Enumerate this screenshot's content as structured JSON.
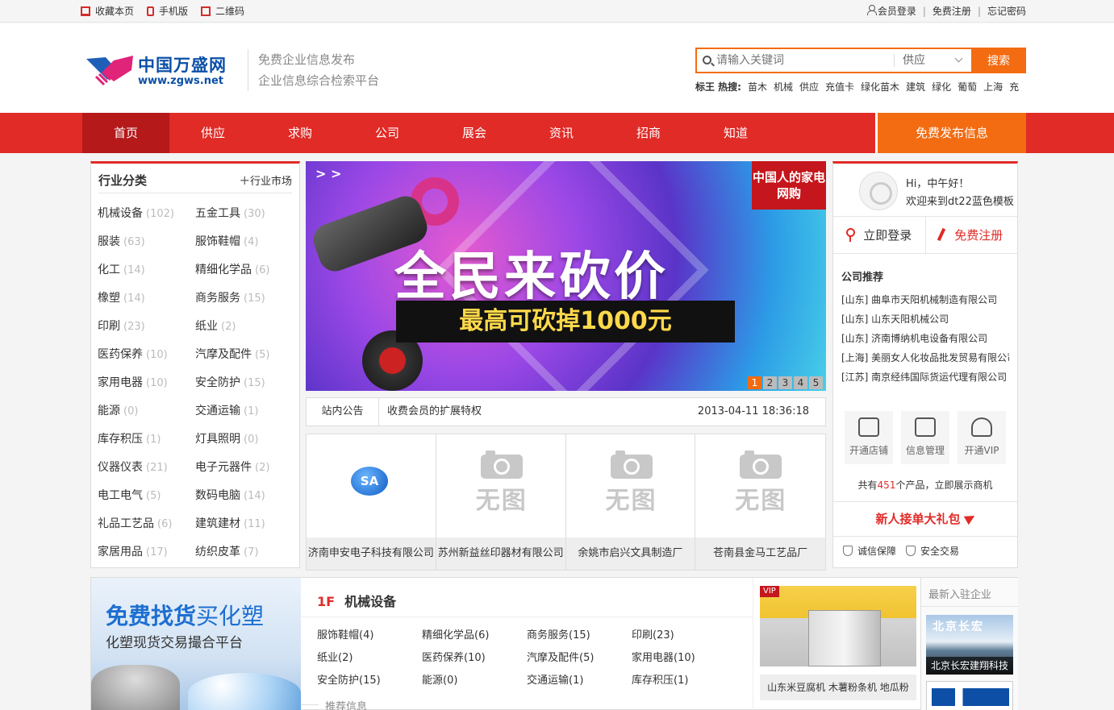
{
  "topbar": {
    "left": [
      "收藏本页",
      "手机版",
      "二维码"
    ],
    "login": "会员登录",
    "register": "免费注册",
    "forgot": "忘记密码",
    "sep": "|"
  },
  "logo": {
    "brand": "中国万盛网",
    "url": "www.zgws.net"
  },
  "slogan": [
    "免费企业信息发布",
    "企业信息综合检索平台"
  ],
  "search": {
    "placeholder": "请输入关键词",
    "type": "供应",
    "button": "搜索"
  },
  "hot": {
    "label": "标王 热搜:",
    "words": [
      "苗木",
      "机械",
      "供应",
      "充值卡",
      "绿化苗木",
      "建筑",
      "绿化",
      "葡萄",
      "上海",
      "充"
    ]
  },
  "nav": {
    "items": [
      "首页",
      "供应",
      "求购",
      "公司",
      "展会",
      "资讯",
      "招商",
      "知道"
    ],
    "publish": "免费发布信息"
  },
  "categories": {
    "title": "行业分类",
    "market": "行业市场",
    "items": [
      {
        "name": "机械设备",
        "count": "(102)"
      },
      {
        "name": "五金工具",
        "count": "(30)"
      },
      {
        "name": "服装",
        "count": "(63)"
      },
      {
        "name": "服饰鞋帽",
        "count": "(4)"
      },
      {
        "name": "化工",
        "count": "(14)"
      },
      {
        "name": "精细化学品",
        "count": "(6)"
      },
      {
        "name": "橡塑",
        "count": "(14)"
      },
      {
        "name": "商务服务",
        "count": "(15)"
      },
      {
        "name": "印刷",
        "count": "(23)"
      },
      {
        "name": "纸业",
        "count": "(2)"
      },
      {
        "name": "医药保养",
        "count": "(10)"
      },
      {
        "name": "汽摩及配件",
        "count": "(5)"
      },
      {
        "name": "家用电器",
        "count": "(10)"
      },
      {
        "name": "安全防护",
        "count": "(15)"
      },
      {
        "name": "能源",
        "count": "(0)"
      },
      {
        "name": "交通运输",
        "count": "(1)"
      },
      {
        "name": "库存积压",
        "count": "(1)"
      },
      {
        "name": "灯具照明",
        "count": "(0)"
      },
      {
        "name": "仪器仪表",
        "count": "(21)"
      },
      {
        "name": "电子元器件",
        "count": "(2)"
      },
      {
        "name": "电工电气",
        "count": "(5)"
      },
      {
        "name": "数码电脑",
        "count": "(14)"
      },
      {
        "name": "礼品工艺品",
        "count": "(6)"
      },
      {
        "name": "建筑建材",
        "count": "(11)"
      },
      {
        "name": "家居用品",
        "count": "(17)"
      },
      {
        "name": "纺织皮革",
        "count": "(7)"
      }
    ]
  },
  "banner": {
    "main": "全民来砍价",
    "sub": "最高可砍掉1000元",
    "corner": "中国人的家电网购",
    "arrows": "> >",
    "dots": [
      "1",
      "2",
      "3",
      "4",
      "5"
    ],
    "active_dot": 0
  },
  "notice": {
    "label": "站内公告",
    "text": "收费会员的扩展特权",
    "time": "2013-04-11 18:36:18"
  },
  "companies": [
    {
      "name": "济南申安电子科技有限公司",
      "logo": "SA"
    },
    {
      "name": "苏州新益丝印器材有限公司",
      "noimg": "无图"
    },
    {
      "name": "余姚市启兴文具制造厂",
      "noimg": "无图"
    },
    {
      "name": "苍南县金马工艺品厂",
      "noimg": "无图"
    }
  ],
  "user": {
    "greet1": "Hi，中午好！",
    "greet2": "欢迎来到dt22蓝色模板",
    "login": "立即登录",
    "register": "免费注册",
    "rec_title": "公司推荐",
    "rec": [
      "[山东] 曲阜市天阳机械制造有限公司",
      "[山东] 山东天阳机械公司",
      "[山东] 济南博纳机电设备有限公司",
      "[上海] 美丽女人化妆品批发贸易有限公司",
      "[江苏] 南京经纬国际货运代理有限公司"
    ],
    "tools": [
      "开通店铺",
      "信息管理",
      "开通VIP"
    ],
    "count_pre": "共有",
    "count": "451",
    "count_post": "个产品，立即展示商机",
    "gift": "新人接单大礼包",
    "safe": [
      "诚信保障",
      "安全交易"
    ]
  },
  "floor": {
    "ad1a": "免费找货",
    "ad1b": "买化塑",
    "ad2": "化塑现货交易撮合平台",
    "num": "1F",
    "title": "机械设备",
    "links": [
      "服饰鞋帽(4)",
      "精细化学品(6)",
      "商务服务(15)",
      "印刷(23)",
      "纸业(2)",
      "医药保养(10)",
      "汽摩及配件(5)",
      "家用电器(10)",
      "安全防护(15)",
      "能源(0)",
      "交通运输(1)",
      "库存积压(1)"
    ],
    "recommend": "推荐信息",
    "vip": "VIP",
    "product": "山东米豆腐机 木薯粉条机 地瓜粉",
    "new_title": "最新入驻企业",
    "new1": "北京长宏建翔科技",
    "new1_sign": "北京长宏"
  },
  "colors": {
    "red": "#e02b27",
    "orange": "#f36c12",
    "dark_red": "#b5191a",
    "blue": "#0b4fa6"
  }
}
